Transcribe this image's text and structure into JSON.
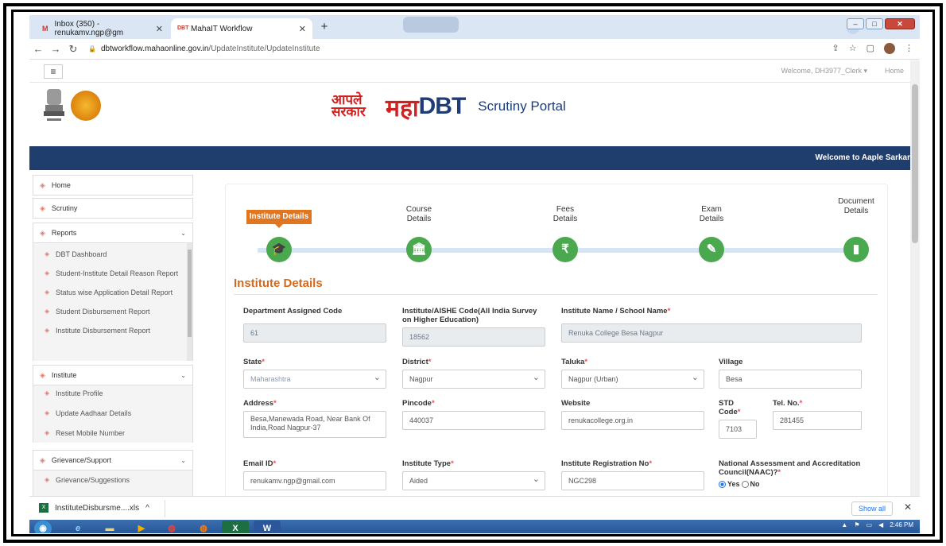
{
  "browser": {
    "tabs": [
      {
        "label": "Inbox (350) - renukamv.ngp@gm",
        "favicon": "gmail-icon"
      },
      {
        "label": "MahaIT Workflow",
        "favicon": "dbt-icon"
      }
    ],
    "new_tab": "+",
    "url_domain": "dbtworkflow.mahaonline.gov.in",
    "url_path": "/UpdateInstitute/UpdateInstitute"
  },
  "topstrip": {
    "welcome": "Welcome, DH3977_Clerk ▾",
    "home": "Home"
  },
  "header": {
    "logo_aple": "आपले सरकार",
    "logo_maha": "महा",
    "logo_dbt": "DBT",
    "portal_title": "Scrutiny Portal",
    "banner": "Welcome to Aaple Sarkar"
  },
  "sidebar": {
    "home": "Home",
    "scrutiny": "Scrutiny",
    "reports": "Reports",
    "reports_items": [
      "DBT Dashboard",
      "Student-Institute Detail Reason Report",
      "Status wise Application Detail Report",
      "Student Disbursement Report",
      "Institute Disbursement Report"
    ],
    "institute": "Institute",
    "institute_items": [
      "Institute Profile",
      "Update Aadhaar Details",
      "Reset Mobile Number"
    ],
    "grievance": "Grievance/Support",
    "grievance_items": [
      "Grievance/Suggestions"
    ]
  },
  "steps": [
    {
      "label": "Institute Details",
      "icon": "graduation-cap-icon",
      "glyph": "🎓"
    },
    {
      "label": "Course Details",
      "icon": "institution-icon",
      "glyph": "🏛"
    },
    {
      "label": "Fees Details",
      "icon": "rupee-icon",
      "glyph": "₹"
    },
    {
      "label": "Exam Details",
      "icon": "edit-icon",
      "glyph": "✎"
    },
    {
      "label": "Document Details",
      "icon": "document-icon",
      "glyph": "▮"
    }
  ],
  "form": {
    "section_title": "Institute Details",
    "dept_code_label": "Department Assigned Code",
    "dept_code": "61",
    "aishe_label": "Institute/AISHE Code(All India Survey on Higher Education)",
    "aishe": "18562",
    "inst_name_label": "Institute Name / School Name",
    "inst_name": "Renuka College Besa Nagpur",
    "state_label": "State",
    "state": "Maharashtra",
    "district_label": "District",
    "district": "Nagpur",
    "taluka_label": "Taluka",
    "taluka": "Nagpur (Urban)",
    "village_label": "Village",
    "village": "Besa",
    "address_label": "Address",
    "address": "Besa,Manewada Road, Near Bank Of India,Road Nagpur-37",
    "pincode_label": "Pincode",
    "pincode": "440037",
    "website_label": "Website",
    "website": "renukacollege.org.in",
    "std_label": "STD Code",
    "std": "7103",
    "tel_label": "Tel. No.",
    "tel": "281455",
    "email_label": "Email ID",
    "email": "renukamv.ngp@gmail.com",
    "inst_type_label": "Institute Type",
    "inst_type": "Aided",
    "reg_no_label": "Institute Registration No",
    "reg_no": "NGC298",
    "naac_label": "National Assessment and Accreditation Council(NAAC)?",
    "naac_yes": "Yes",
    "naac_no": "No",
    "required_mark": "*"
  },
  "downloads": {
    "file": "InstituteDisbursme....xls",
    "show_all": "Show all"
  },
  "taskbar": {
    "time": "2:46 PM"
  }
}
